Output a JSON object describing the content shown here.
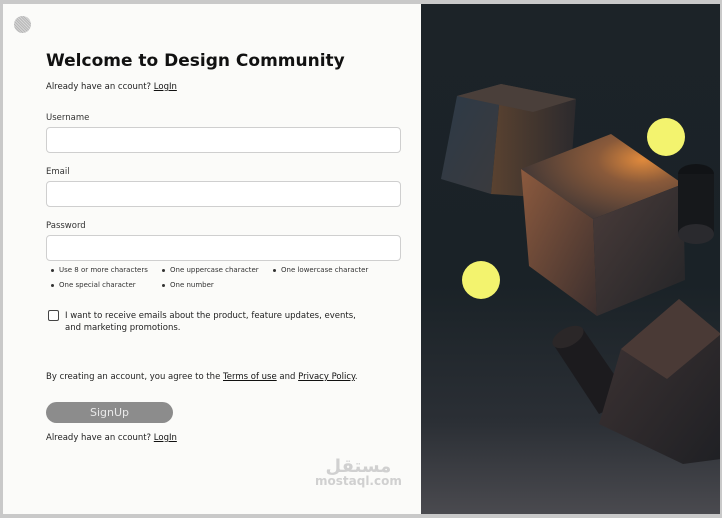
{
  "title": "Welcome to Design Community",
  "header_prompt": {
    "text": "Already have an ccount?",
    "link": "LogIn"
  },
  "fields": {
    "username": {
      "label": "Username",
      "value": "",
      "placeholder": ""
    },
    "email": {
      "label": "Email",
      "value": "",
      "placeholder": ""
    },
    "password": {
      "label": "Password",
      "value": "",
      "placeholder": ""
    }
  },
  "password_rules": [
    "Use 8 or more characters",
    "One uppercase character",
    "One lowercase character",
    "One special character",
    "One number"
  ],
  "marketing_opt_in": {
    "label": "I want to receive emails about the product, feature updates, events, and marketing promotions.",
    "checked": false
  },
  "terms": {
    "prefix": "By creating an account, you agree to the",
    "terms_link": "Terms of use",
    "and": "and",
    "privacy_link": "Privacy Policy",
    "suffix": "."
  },
  "signup_button": "SignUp",
  "footer_prompt": {
    "text": "Already have an ccount?",
    "link": "LogIn"
  },
  "watermark": {
    "arabic": "مستقل",
    "latin": "mostaql.com"
  },
  "colors": {
    "accent_yellow": "#f3f36e",
    "button_disabled": "#8c8c8c",
    "panel_dark": "#1c2328"
  }
}
